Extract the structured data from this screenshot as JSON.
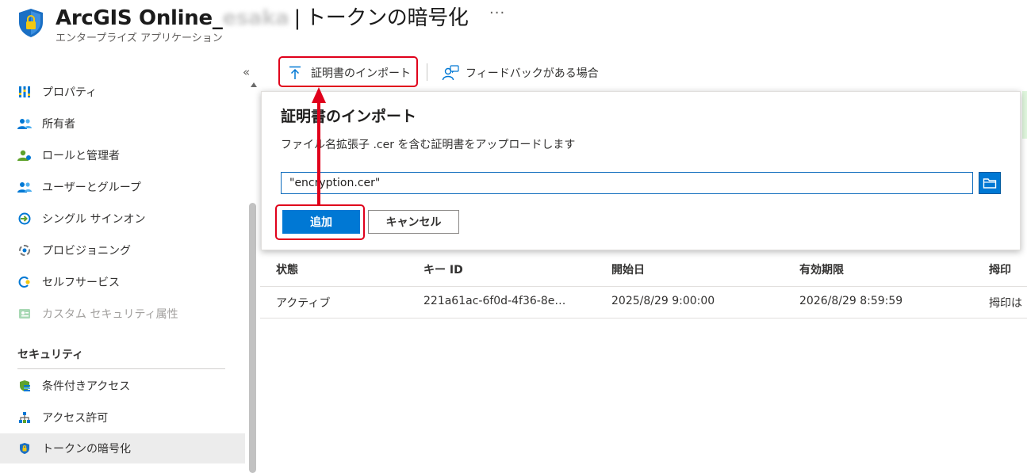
{
  "header": {
    "title_prefix": "ArcGIS Online_",
    "title_redacted": "esaka",
    "title_separator": "|",
    "page_name": "トークンの暗号化",
    "more": "···",
    "subtitle": "エンタープライズ アプリケーション"
  },
  "sidebar": {
    "collapse": "«",
    "items": [
      {
        "label": "プロパティ",
        "icon": "properties-icon"
      },
      {
        "label": "所有者",
        "icon": "owners-icon"
      },
      {
        "label": "ロールと管理者",
        "icon": "roles-admins-icon"
      },
      {
        "label": "ユーザーとグループ",
        "icon": "users-groups-icon"
      },
      {
        "label": "シングル サインオン",
        "icon": "single-signon-icon"
      },
      {
        "label": "プロビジョニング",
        "icon": "provisioning-icon"
      },
      {
        "label": "セルフサービス",
        "icon": "self-service-icon"
      },
      {
        "label": "カスタム セキュリティ属性",
        "icon": "custom-attributes-icon"
      }
    ],
    "section_security": "セキュリティ",
    "security_items": [
      {
        "label": "条件付きアクセス",
        "icon": "conditional-access-icon"
      },
      {
        "label": "アクセス許可",
        "icon": "permissions-icon"
      },
      {
        "label": "トークンの暗号化",
        "icon": "shield-icon"
      }
    ]
  },
  "toolbar": {
    "import_label": "証明書のインポート",
    "feedback_label": "フィードバックがある場合"
  },
  "table": {
    "headers": [
      "状態",
      "キー ID",
      "開始日",
      "有効期限",
      "拇印"
    ],
    "rows": [
      [
        "アクティブ",
        "221a61ac-6f0d-4f36-8e…",
        "2025/8/29 9:00:00",
        "2026/8/29 8:59:59",
        "拇印は"
      ]
    ]
  },
  "panel": {
    "title": "証明書のインポート",
    "description": "ファイル名拡張子 .cer を含む証明書をアップロードします",
    "file_value": "\"encryption.cer\"",
    "add_label": "追加",
    "cancel_label": "キャンセル"
  },
  "colors": {
    "accent": "#0078d4",
    "annotation": "#e0001b"
  }
}
